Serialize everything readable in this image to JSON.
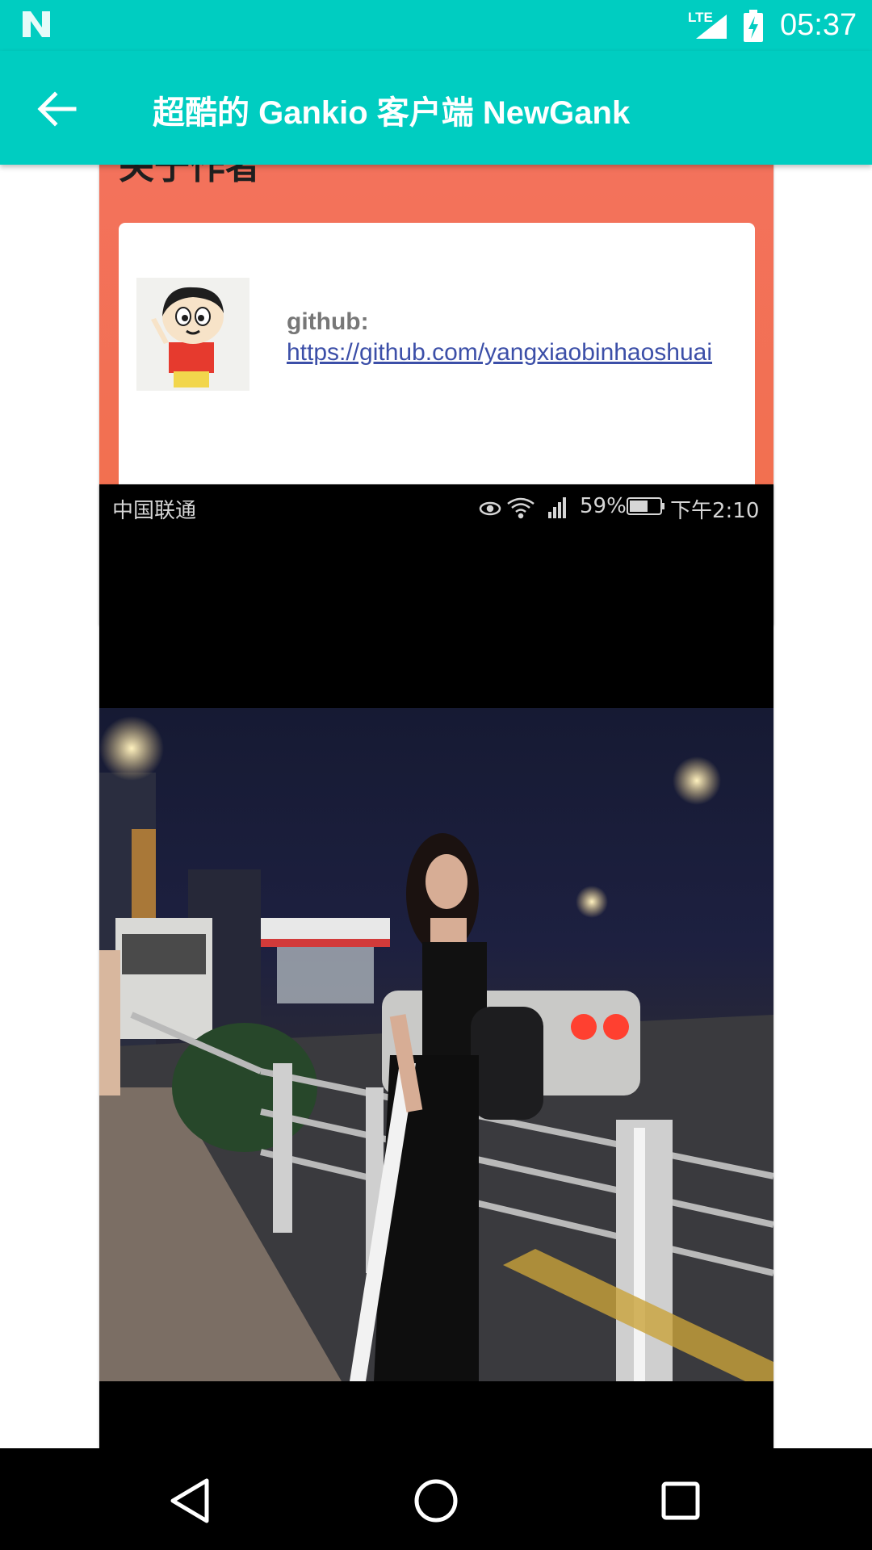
{
  "status_bar": {
    "network": "LTE",
    "time": "05:37",
    "icons": [
      "notification-n-icon",
      "lte-signal-icon",
      "battery-charging-icon"
    ]
  },
  "app_bar": {
    "title": "超酷的 Gankio 客户端 NewGank",
    "back_icon": "arrow-back-icon"
  },
  "about_card": {
    "heading": "关于作者",
    "github_label": "github:",
    "github_link": " https://github.com/yangxiaobinhaoshuai",
    "avatar_icon": "cartoon-avatar-icon",
    "nav_icons": [
      "back-triangle-icon",
      "home-circle-icon",
      "recents-square-icon"
    ]
  },
  "photo_card": {
    "carrier": "中国联通",
    "battery_percent": "59%",
    "clock": "下午2:10",
    "status_icons": [
      "eye-icon",
      "wifi-icon",
      "4g-signal-icon",
      "battery-icon"
    ],
    "photo_icon": "night-street-photo"
  },
  "nav_bar": {
    "icons": [
      "back-triangle-icon",
      "home-circle-icon",
      "recents-square-icon"
    ]
  },
  "colors": {
    "accent": "#00cdc1",
    "banner": "#f3725c",
    "link": "#3c4fa8"
  }
}
